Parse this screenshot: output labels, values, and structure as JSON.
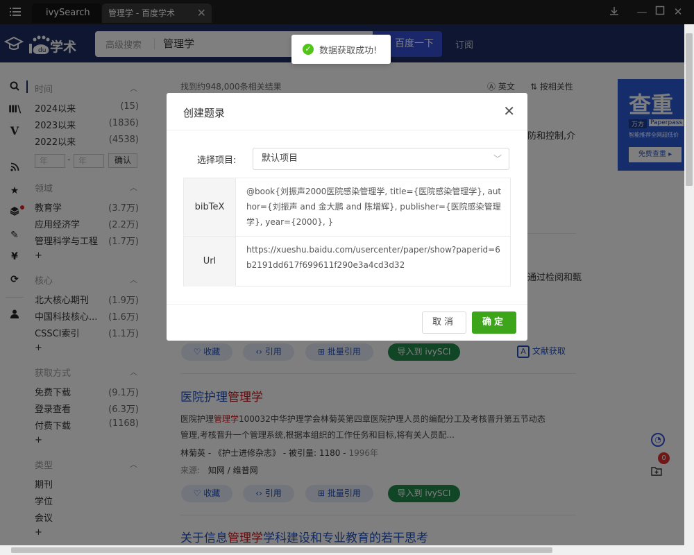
{
  "window": {
    "tabs": [
      {
        "label": "ivySearch"
      },
      {
        "label": "管理学 - 百度学术"
      }
    ],
    "colors": {
      "titlebar": "#1e1e1e",
      "header": "#1c2c62",
      "accent": "#3451d6"
    }
  },
  "header": {
    "logo": "学术",
    "advanced_search": "高级搜索",
    "query": "管理学",
    "search_button": "百度一下",
    "subscribe": "订阅"
  },
  "toast": {
    "message": "数据获取成功!"
  },
  "filters": {
    "time": {
      "title": "时间",
      "items": [
        {
          "label": "2024以来",
          "count": "(15)"
        },
        {
          "label": "2023以来",
          "count": "(1836)"
        },
        {
          "label": "2022以来",
          "count": "(4538)"
        }
      ],
      "year_from_placeholder": "年",
      "range_dash": "-",
      "year_to_placeholder": "年",
      "confirm": "确认"
    },
    "field": {
      "title": "领域",
      "items": [
        {
          "label": "教育学",
          "count": "(3.7万)"
        },
        {
          "label": "应用经济学",
          "count": "(2.2万)"
        },
        {
          "label": "管理科学与工程",
          "count": "(1.7万)"
        }
      ],
      "more": "+"
    },
    "core": {
      "title": "核心",
      "items": [
        {
          "label": "北大核心期刊",
          "count": "(1.9万)"
        },
        {
          "label": "中国科技核心...",
          "count": "(1.6万)"
        },
        {
          "label": "CSSCI索引",
          "count": "(1.1万)"
        }
      ],
      "more": "+"
    },
    "access": {
      "title": "获取方式",
      "items": [
        {
          "label": "免费下载",
          "count": "(9.1万)"
        },
        {
          "label": "登录查看",
          "count": "(6.3万)"
        },
        {
          "label": "付费下载",
          "count": "(1168)"
        }
      ],
      "more": "+"
    },
    "type": {
      "title": "类型",
      "items": [
        {
          "label": "期刊"
        },
        {
          "label": "学位"
        },
        {
          "label": "会议"
        }
      ],
      "more": "+"
    }
  },
  "results": {
    "summary": "找到约948,000条相关结果",
    "lang_toggle": "英文",
    "sort": "按相关性",
    "snippet_fragment_1": "防和控制,介",
    "snippet_fragment_2": "通过检阅和甄",
    "actions": {
      "favorite": "收藏",
      "cite": "引用",
      "batch_cite": "批量引用",
      "import": "导入到 ivySCI",
      "get_fulltext": "文献获取"
    },
    "item2": {
      "title_prefix": "医院护理",
      "title_highlight": "管理学",
      "snippet_prefix": "医院护理",
      "snippet_highlight": "管理学",
      "snippet_line1": "100032中华护理学会林菊英第四章医院护理人员的编配分工及考核晋升第五节动态",
      "snippet_line2": "管理,考核晋升一个管理系统,根据本组织的工作任务和目标,将有关人员配...",
      "author": "林菊英",
      "journal": "《护士进修杂志》",
      "cited_label": "被引量:",
      "cited_count": "1180",
      "year": "1996年",
      "dash": "-",
      "source_label": "来源:",
      "source_1": "知网",
      "source_sep": "/",
      "source_2": "维普网"
    },
    "item3": {
      "title_prefix": "关于信息",
      "title_highlight": "管理学",
      "title_suffix": "学科建设和专业教育的若干思考"
    }
  },
  "ad": {
    "title": "查重",
    "brand_1": "万方",
    "brand_2": "Paperpass",
    "tagline": "智能推荐全网超低价",
    "button": "免费查重 ▸"
  },
  "floating": {
    "badge": "0"
  },
  "dialog": {
    "title": "创建题录",
    "project_label": "选择项目:",
    "project_value": "默认项目",
    "bibtex_label": "bibTeX",
    "bibtex_value": "@book{刘振声2000医院感染管理学, title={医院感染管理学}, author={刘振声 and 金大鹏 and 陈增辉}, publisher={医院感染管理学}, year={2000}, }",
    "url_label": "Url",
    "url_value": "https://xueshu.baidu.com/usercenter/paper/show?paperid=6b2191dd617f699611f290e3a4cd3d32",
    "cancel": "取消",
    "ok": "确定"
  }
}
